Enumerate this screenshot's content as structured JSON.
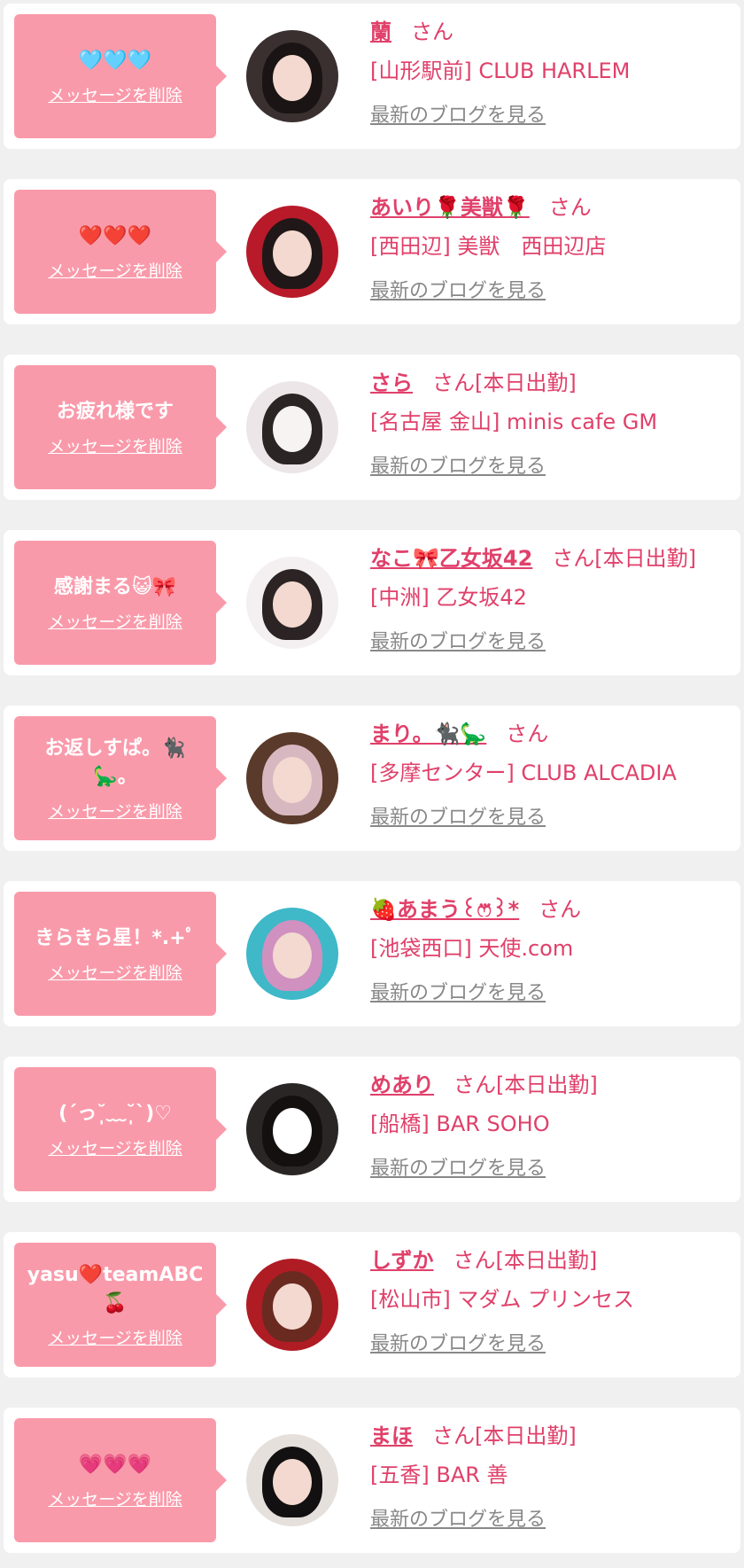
{
  "delete_label": "メッセージを削除",
  "blog_label": "最新のブログを見る",
  "san_label": "さん",
  "colors": {
    "accent": "#e0406a",
    "bubble": "#f99aaa",
    "background": "#f0f0f0",
    "blog_link": "#888888"
  },
  "cards": [
    {
      "message": "🩵🩵🩵",
      "name": "蘭",
      "status": "",
      "shop": "[山形駅前] CLUB HARLEM"
    },
    {
      "message": "❤️❤️❤️",
      "name": "あいり🌹美獣🌹",
      "status": "",
      "shop": "[西田辺] 美獣　西田辺店"
    },
    {
      "message": "お疲れ様です",
      "name": "さら",
      "status": "[本日出勤]",
      "shop": "[名古屋 金山] minis cafe GM"
    },
    {
      "message": "感謝まる😺🎀",
      "name": "なこ🎀乙女坂42",
      "status": "[本日出勤]",
      "shop": "[中洲] 乙女坂42"
    },
    {
      "message": "お返しすぱ。🐈‍⬛🦕。",
      "name": "まり。🐈‍⬛🦕",
      "status": "",
      "shop": "[多摩センター] CLUB ALCADIA"
    },
    {
      "message": "きらきら星！*.+ﾟ",
      "name": "🍓あまう꒰ෆ⃛꒱*",
      "status": "",
      "shop": "[池袋西口] 天使.com"
    },
    {
      "message": "(ˊっ˘̩̩̩﹏˘̩̩̩ˋ)♡",
      "name": "めあり",
      "status": "[本日出勤]",
      "shop": "[船橋] BAR SOHO"
    },
    {
      "message": "yasu❤️teamABC🍒",
      "name": "しずか",
      "status": "[本日出勤]",
      "shop": "[松山市] マダム プリンセス"
    },
    {
      "message": "💗💗💗",
      "name": "まほ",
      "status": "[本日出勤]",
      "shop": "[五香] BAR 善"
    }
  ]
}
